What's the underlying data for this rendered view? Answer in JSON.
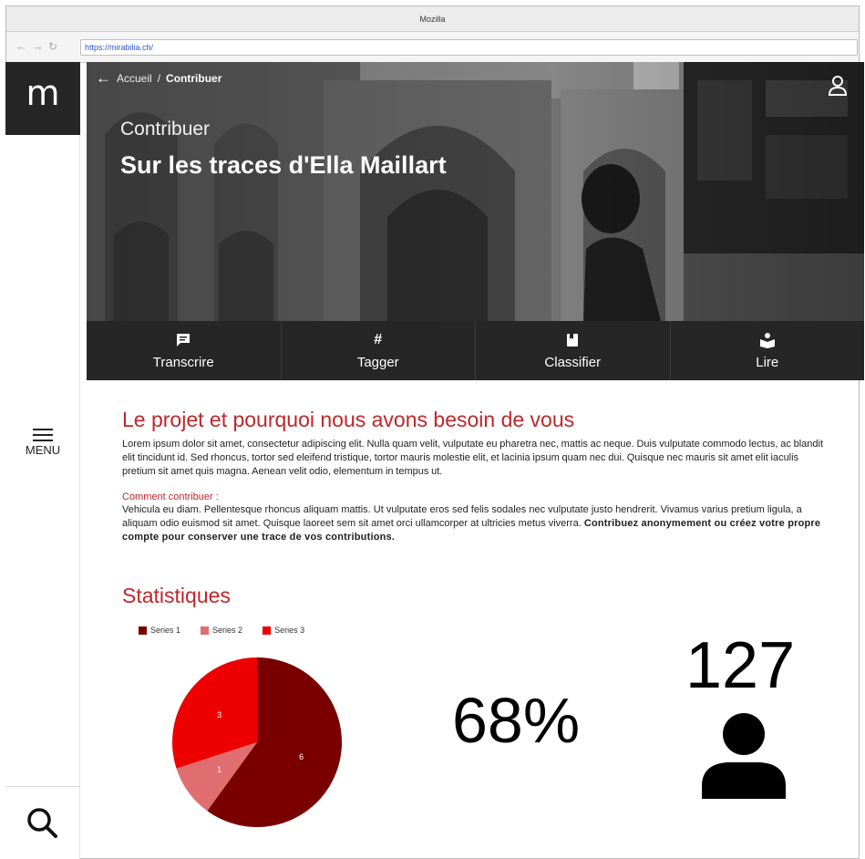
{
  "browser": {
    "title": "Mozilla",
    "url": "https://mirabilia.ch/"
  },
  "sidebar": {
    "logo": "m",
    "menu_label": "MENU"
  },
  "hero": {
    "breadcrumb_home": "Accueil",
    "breadcrumb_sep": "/",
    "breadcrumb_current": "Contribuer",
    "kicker": "Contribuer",
    "title": "Sur les traces d'Ella Maillart"
  },
  "tabs": [
    {
      "label": "Transcrire",
      "icon": "speech-bubble-icon"
    },
    {
      "label": "Tagger",
      "icon": "hashtag-icon"
    },
    {
      "label": "Classifier",
      "icon": "bookmark-icon"
    },
    {
      "label": "Lire",
      "icon": "reader-icon"
    }
  ],
  "intro": {
    "heading": "Le projet et pourquoi nous avons besoin de vous",
    "body": "Lorem ipsum dolor sit amet, consectetur adipiscing elit. Nulla quam velit, vulputate eu pharetra nec, mattis ac neque. Duis vulputate commodo lectus, ac blandit elit tincidunt id. Sed rhoncus, tortor sed eleifend tristique, tortor mauris molestie elit, et lacinia ipsum quam nec dui. Quisque nec mauris sit amet elit iaculis pretium sit amet quis magna. Aenean velit odio, elementum in tempus ut.",
    "how_label": "Comment contribuer :",
    "how_body": "Vehicula eu diam. Pellentesque rhoncus aliquam mattis. Ut vulputate eros sed felis sodales nec vulputate justo hendrerit. Vivamus varius pretium ligula, a aliquam odio euismod sit amet. Quisque laoreet sem sit amet orci ullamcorper at ultricies metus viverra.",
    "how_bold": "Contribuez anonymement ou créez votre propre compte pour conserver une trace de vos contributions."
  },
  "stats": {
    "heading": "Statistiques",
    "percent": "68%",
    "count": "127"
  },
  "colors": {
    "accent": "#c0262a",
    "dark": "#262626",
    "series1": "#7a0000",
    "series2": "#e06d70",
    "series3": "#ee0000"
  },
  "chart_data": {
    "type": "pie",
    "series": [
      {
        "name": "Series 1",
        "value": 6,
        "color": "#7a0000"
      },
      {
        "name": "Series 2",
        "value": 1,
        "color": "#e06d70"
      },
      {
        "name": "Series 3",
        "value": 3,
        "color": "#ee0000"
      }
    ],
    "legend": "top"
  }
}
